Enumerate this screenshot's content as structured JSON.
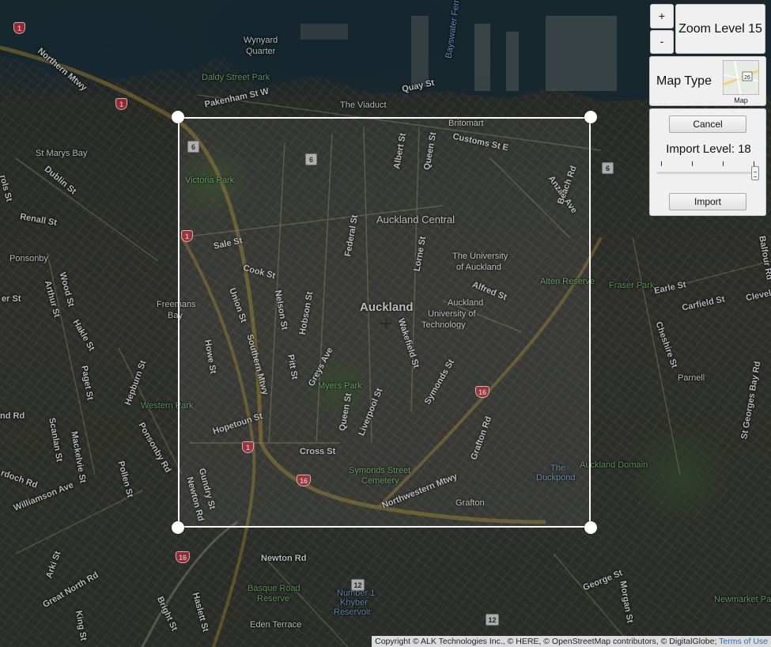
{
  "controls": {
    "zoom_in_label": "+",
    "zoom_out_label": "-",
    "zoom_level_text": "Zoom Level 15",
    "map_type_label": "Map Type",
    "map_type_thumb_label": "Map",
    "map_type_thumb_shield": "26",
    "cancel_label": "Cancel",
    "import_level_text": "Import Level: 18",
    "import_label": "Import",
    "import_level_value": 18,
    "import_level_min": 0,
    "import_level_max": 18
  },
  "copyright": {
    "text": "Copyright © ALK Technologies Inc., © HERE, © OpenStreetMap contributors, © DigitalGlobe;",
    "terms_label": "Terms of Use"
  },
  "map": {
    "place_labels": {
      "auckland": "Auckland",
      "auckland_central": "Auckland Central",
      "uni_auckland_1": "The University",
      "uni_auckland_2": "of Auckland",
      "aut_1": "Auckland",
      "aut_2": "University of",
      "aut_3": "Technology",
      "britomart": "Britomart",
      "wynyard_1": "Wynyard",
      "wynyard_2": "Quarter",
      "viaduct": "The Viaduct",
      "st_marys_bay": "St Marys Bay",
      "ponsonby": "Ponsonby",
      "freemans_1": "Freemans",
      "freemans_2": "Bay",
      "parnell": "Parnell",
      "grafton": "Grafton",
      "eden_terrace": "Eden Terrace"
    },
    "park_labels": {
      "victoria_park": "Victoria Park",
      "albert_park": "Albert Park",
      "myers_park": "Myers Park",
      "western_park": "Western Park",
      "auckland_domain": "Auckland Domain",
      "symonds_cemetery_1": "Symonds Street",
      "symonds_cemetery_2": "Cemetery",
      "basque_1": "Basque Road",
      "basque_2": "Reserve",
      "khyber_1": "Number 1",
      "khyber_2": "Khyber",
      "khyber_3": "Reservoir",
      "daldy_park": "Daldy Street Park",
      "alten_reserve": "Alten Reserve",
      "fraser_park": "Fraser Park",
      "newmarket_park": "Newmarket Park",
      "the_duckpond_1": "The",
      "the_duckpond_2": "Duckpond"
    },
    "street_labels": {
      "quay_st": "Quay St",
      "customs_st": "Customs St E",
      "albert_st": "Albert St",
      "queen_st": "Queen St",
      "federal_st": "Federal St",
      "lorne_st": "Lorne St",
      "alfred_st": "Alfred St",
      "anzac_ave": "Anzac Ave",
      "beach_rd": "Beach Rd",
      "sale_st": "Sale St",
      "cook_st": "Cook St",
      "nelson_st": "Nelson St",
      "hobson_st": "Hobson St",
      "union_st": "Union St",
      "howe_st": "Howe St",
      "pitt_st": "Pitt St",
      "greys_ave": "Greys Ave",
      "wakefield_st": "Wakefield St",
      "symonds_st": "Symonds St",
      "liverpool_st": "Liverpool St",
      "queen_st_2": "Queen St",
      "hopetoun_st": "Hopetoun St",
      "cross_st": "Cross St",
      "gundry_st": "Gundry St",
      "newton_rd": "Newton Rd",
      "newton_rd_2": "Newton Rd",
      "grafton_rd": "Grafton Rd",
      "northwestern_mtwy": "Northwestern Mtwy",
      "southern_mtwy": "Southern Mtwy",
      "northern_mtwy": "Northern Mtwy",
      "pakenham_st": "Pakenham St W",
      "dublin_st": "Dublin St",
      "renall_st": "Renall St",
      "wood_st": "Wood St",
      "arthur_st": "Arthur St",
      "hakle_st": "Hakle St",
      "paget_st": "Paget St",
      "hepburn_st": "Hepburn St",
      "scanlan_st": "Scanlan St",
      "mackelvie_st": "Mackelvie St",
      "ponsonby_rd": "Ponsonby Rd",
      "pollen_st": "Pollen St",
      "williamson_ave": "Williamson Ave",
      "great_north_rd": "Great North Rd",
      "arki_st": "Arki St",
      "king_st": "King St",
      "bright_st": "Bright St",
      "haslett_st": "Haslett St",
      "george_st": "George St",
      "morgan_st": "Morgan St",
      "carfield_st": "Carfield St",
      "cheshire_st": "Cheshire St",
      "st_georges_bay_rd": "St Georges Bay Rd",
      "eden_st": "Earle St",
      "cleveland": "Clevel",
      "balfour": "Balfour Rd",
      "bayswater": "Bayswater Ferry",
      "nd_rd": "nd Rd",
      "ock_rd": "rdoch Rd",
      "er_st": "er St",
      "rols": "rols St"
    },
    "shields": {
      "s1a": "1",
      "s1b": "1",
      "s1c": "1",
      "s1d": "1",
      "s16a": "16",
      "s16b": "16",
      "s16c": "16",
      "s6a": "6",
      "s6b": "6",
      "s6c": "6",
      "s12a": "12",
      "s12b": "12"
    }
  }
}
